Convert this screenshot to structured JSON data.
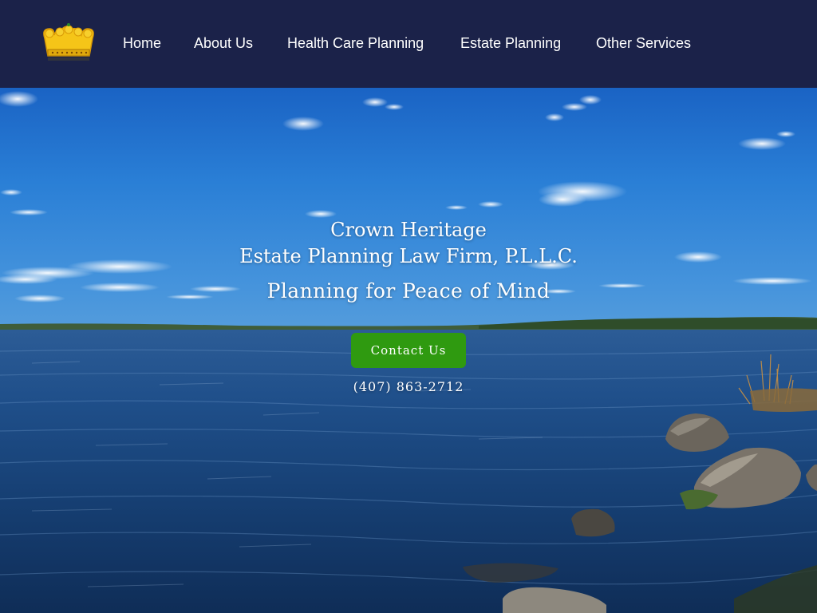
{
  "header": {
    "logo_icon": "crown-icon",
    "nav": [
      {
        "label": "Home"
      },
      {
        "label": "About Us"
      },
      {
        "label": "Health Care Planning"
      },
      {
        "label": "Estate Planning"
      },
      {
        "label": "Other Services"
      }
    ]
  },
  "hero": {
    "title_line1": "Crown Heritage",
    "title_line2": "Estate Planning Law Firm, P.L.L.C.",
    "tagline": "Planning for Peace of Mind",
    "cta_label": "Contact Us",
    "phone": "(407) 863-2712"
  },
  "colors": {
    "header_bg": "#1b2249",
    "cta_bg": "#2f9a10",
    "crown": "#f5c518",
    "text": "#ffffff"
  }
}
